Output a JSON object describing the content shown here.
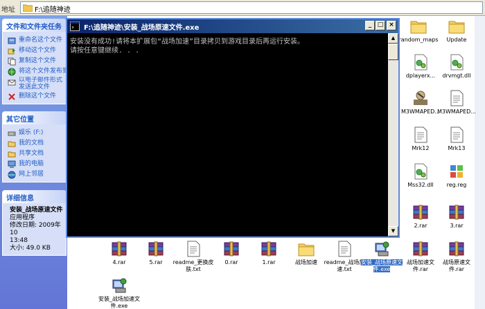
{
  "address_bar": {
    "label": "地址",
    "path": "F:\\追随神迹"
  },
  "task_pane": {
    "file_tasks": {
      "title": "文件和文件夹任务",
      "items": [
        {
          "label": "重命名这个文件",
          "icon": "rename-icon"
        },
        {
          "label": "移动这个文件",
          "icon": "move-icon"
        },
        {
          "label": "复制这个文件",
          "icon": "copy-icon"
        },
        {
          "label": "将这个文件发布到",
          "icon": "publish-web-icon"
        },
        {
          "label": "以电子邮件形式发送此文件",
          "icon": "email-icon"
        },
        {
          "label": "删除这个文件",
          "icon": "delete-icon"
        }
      ]
    },
    "other_places": {
      "title": "其它位置",
      "items": [
        {
          "label": "娱乐 (F:)",
          "icon": "drive-icon"
        },
        {
          "label": "我的文档",
          "icon": "folder-icon"
        },
        {
          "label": "共享文档",
          "icon": "folder-icon"
        },
        {
          "label": "我的电脑",
          "icon": "computer-icon"
        },
        {
          "label": "网上邻居",
          "icon": "network-icon"
        }
      ]
    },
    "details": {
      "title": "详细信息",
      "name": "安装_战场原速文件",
      "type": "应用程序",
      "modified_label": "修改日期: 2009年10",
      "modified_time": "13:48",
      "size": "大小: 49.0 KB"
    }
  },
  "console_window": {
    "title": "F:\\追随神迹\\安装_战场原速文件.exe",
    "lines": [
      "安装没有成功!请将本扩展包“战场加速”目录拷贝到游戏目录后再运行安装。",
      "请按任意键继续. . ."
    ],
    "buttons": {
      "minimize": "_",
      "maximize": "□",
      "close": "×"
    }
  },
  "files": [
    {
      "name": "random_maps",
      "icon": "folder-icon"
    },
    {
      "name": "Update",
      "icon": "folder-icon"
    },
    {
      "name": "dplayerx...",
      "icon": "dll-icon"
    },
    {
      "name": "drvmgt.dll",
      "icon": "dll-icon"
    },
    {
      "name": "M3WMAPED...",
      "icon": "map-editor-icon"
    },
    {
      "name": "M3WMAPED...",
      "icon": "text-file-icon"
    },
    {
      "name": "Mrk12",
      "icon": "text-file-icon"
    },
    {
      "name": "Mrk13",
      "icon": "text-file-icon"
    },
    {
      "name": "Mss32.dll",
      "icon": "dll-icon"
    },
    {
      "name": "reg.reg",
      "icon": "registry-icon"
    },
    {
      "name": "2.rar",
      "icon": "rar-icon"
    },
    {
      "name": "3.rar",
      "icon": "rar-icon"
    },
    {
      "name": "4.rar",
      "icon": "rar-icon"
    },
    {
      "name": "5.rar",
      "icon": "rar-icon"
    },
    {
      "name": "readme_更换皮肤.txt",
      "icon": "text-file-icon"
    },
    {
      "name": "0.rar",
      "icon": "rar-icon"
    },
    {
      "name": "1.rar",
      "icon": "rar-icon"
    },
    {
      "name": "战场加速",
      "icon": "folder-icon"
    },
    {
      "name": "readme_战场加速.txt",
      "icon": "text-file-icon"
    },
    {
      "name": "安装_战场原速文件.exe",
      "icon": "installer-icon",
      "selected": true
    },
    {
      "name": "战场加速文件.rar",
      "icon": "rar-icon"
    },
    {
      "name": "战场原速文件.rar",
      "icon": "rar-icon"
    },
    {
      "name": "安装_战场加速文件.exe",
      "icon": "installer-icon"
    }
  ],
  "colors": {
    "pane_gradient_top": "#7ba2e7",
    "pane_gradient_bottom": "#6375d6",
    "pane_link": "#215dc6",
    "console_bg": "#000000",
    "console_text": "#c0c0c0",
    "titlebar": "#0a246a",
    "selection": "#316ac5"
  }
}
